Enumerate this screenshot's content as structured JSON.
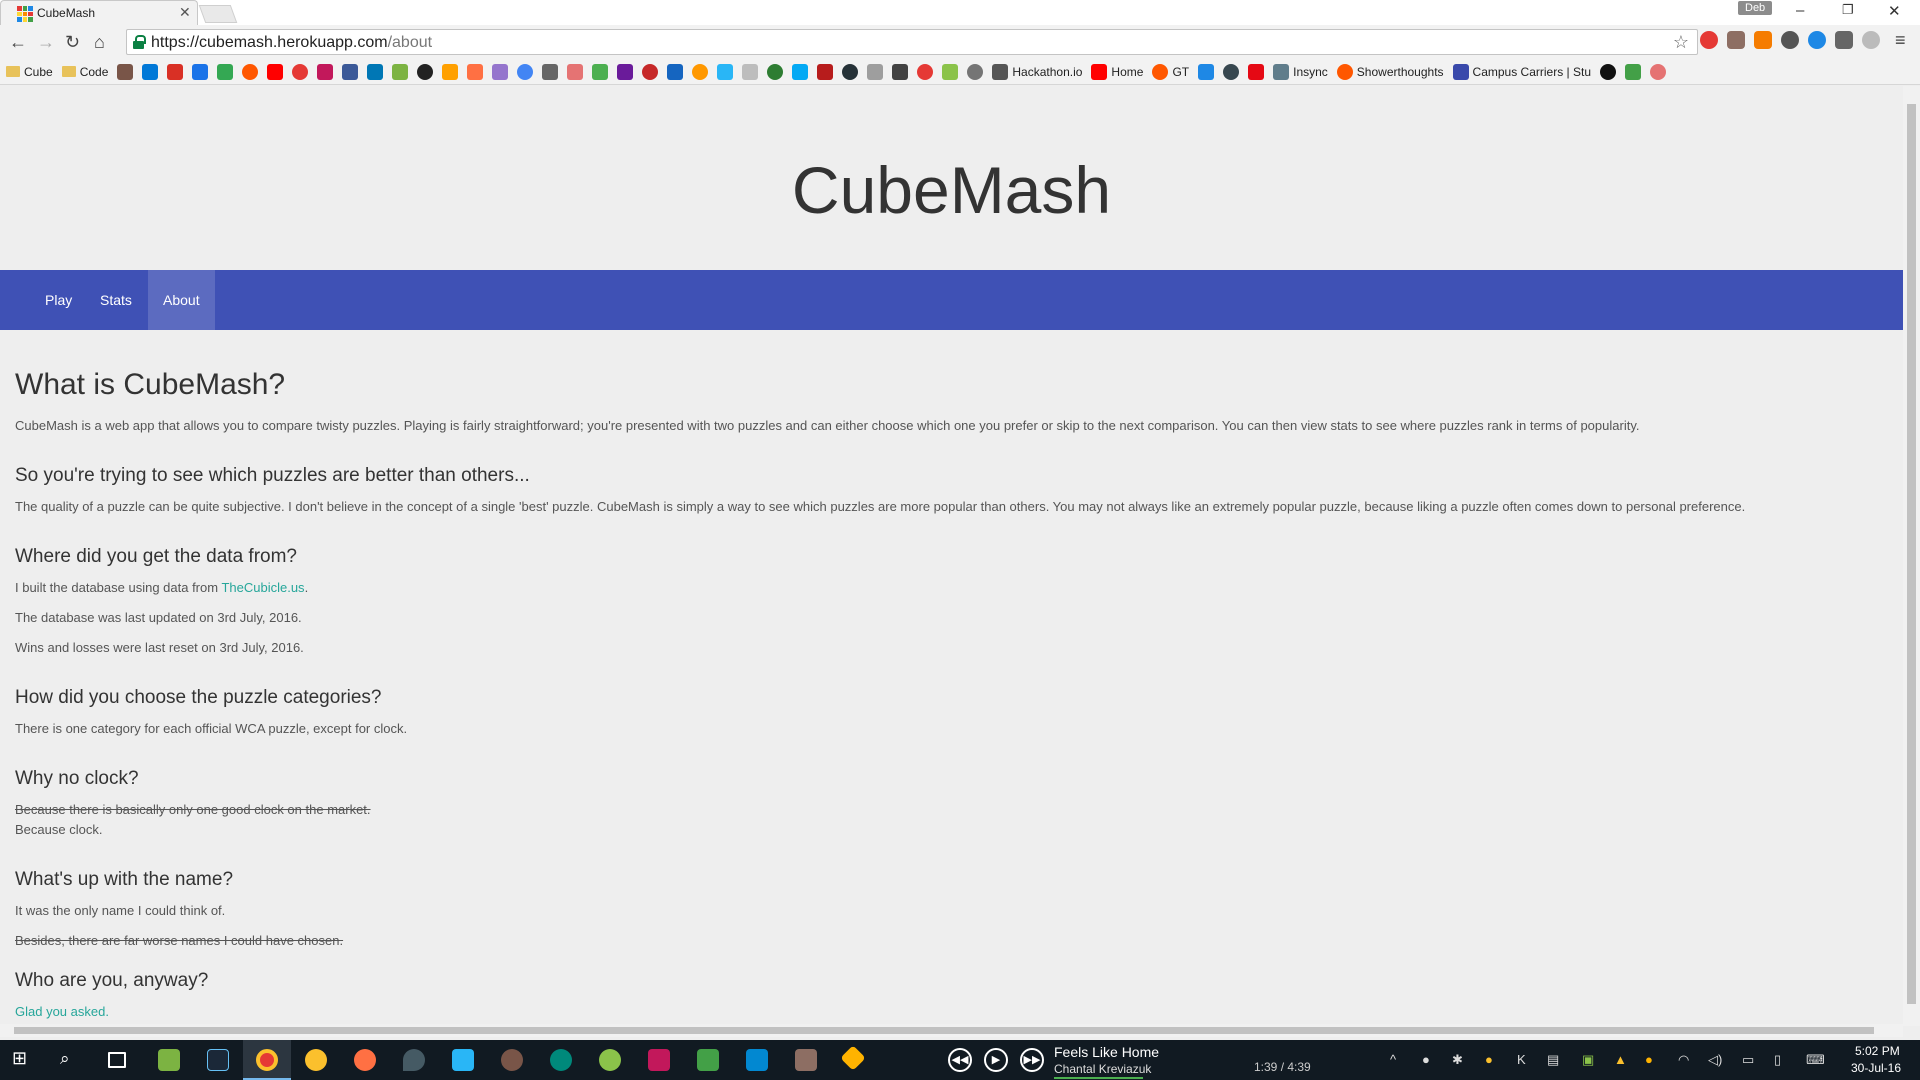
{
  "browser": {
    "tab_title": "CubeMash",
    "profile_name": "Deb",
    "url_host": "https://cubemash.herokuapp.com",
    "url_path": "/about",
    "bookmarks": [
      "Cube",
      "Code",
      "Hackathon.io",
      "Home",
      "GT",
      "Insync",
      "Showerthoughts",
      "Campus Carriers | Stu"
    ]
  },
  "site": {
    "title": "CubeMash",
    "nav": [
      {
        "label": "Play",
        "active": false
      },
      {
        "label": "Stats",
        "active": false
      },
      {
        "label": "About",
        "active": true
      }
    ],
    "accent_color": "#3f51b5",
    "link_color": "#26a69a"
  },
  "about": {
    "heading": "What is CubeMash?",
    "intro": "CubeMash is a web app that allows you to compare twisty puzzles. Playing is fairly straightforward; you're presented with two puzzles and can either choose which one you prefer or skip to the next comparison. You can then view stats to see where puzzles rank in terms of popularity.",
    "better_heading": "So you're trying to see which puzzles are better than others...",
    "better_text": "The quality of a puzzle can be quite subjective. I don't believe in the concept of a single 'best' puzzle. CubeMash is simply a way to see which puzzles are more popular than others. You may not always like an extremely popular puzzle, because liking a puzzle often comes down to personal preference.",
    "data_heading": "Where did you get the data from?",
    "data_text_prefix": "I built the database using data from ",
    "data_link": "TheCubicle.us",
    "data_text_suffix": ".",
    "data_updated": "The database was last updated on 3rd July, 2016.",
    "data_reset": "Wins and losses were last reset on 3rd July, 2016.",
    "categories_heading": "How did you choose the puzzle categories?",
    "categories_text": "There is one category for each official WCA puzzle, except for clock.",
    "clock_heading": "Why no clock?",
    "clock_struck": "Because there is basically only one good clock on the market.",
    "clock_text": "Because clock.",
    "name_heading": "What's up with the name?",
    "name_text": "It was the only name I could think of.",
    "name_struck": "Besides, there are far worse names I could have chosen.",
    "who_heading": "Who are you, anyway?",
    "who_link": "Glad you asked."
  },
  "taskbar": {
    "song_title": "Feels Like Home",
    "song_artist": "Chantal Kreviazuk",
    "song_time": "1:39 / 4:39",
    "song_progress": 0.355,
    "clock_time": "5:02 PM",
    "clock_date": "30-Jul-16"
  }
}
